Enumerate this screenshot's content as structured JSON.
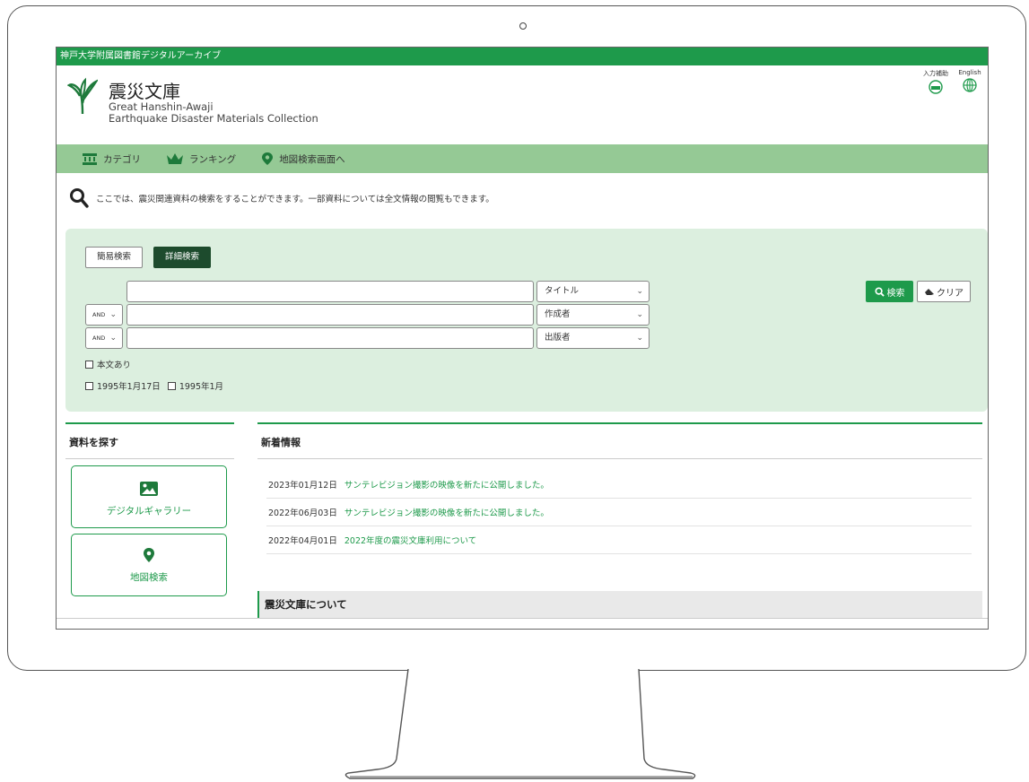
{
  "topbar": {
    "text": "神戸大学附属図書館デジタルアーカイブ"
  },
  "logo": {
    "title": "震災文庫",
    "sub1": "Great Hanshin-Awaji",
    "sub2": "Earthquake Disaster Materials Collection"
  },
  "utility": {
    "input_help": "入力補助",
    "english": "English"
  },
  "nav": {
    "category": "カテゴリ",
    "ranking": "ランキング",
    "map": "地図検索画面へ"
  },
  "intro": {
    "text": "ここでは、震災関連資料の検索をすることができます。一部資料については全文情報の閲覧もできます。"
  },
  "search": {
    "tab_simple": "簡易検索",
    "tab_advanced": "詳細検索",
    "rows": [
      {
        "value": "",
        "field": "タイトル"
      },
      {
        "op": "AND",
        "value": "",
        "field": "作成者"
      },
      {
        "op": "AND",
        "value": "",
        "field": "出版者"
      }
    ],
    "fulltext": "本文あり",
    "date1": "1995年1月17日",
    "date2": "1995年1月",
    "search_button": "検索",
    "clear_button": "クリア"
  },
  "find": {
    "heading": "資料を探す",
    "gallery": "デジタルギャラリー",
    "map": "地図検索"
  },
  "news": {
    "heading": "新着情報",
    "items": [
      {
        "date": "2023年01月12日",
        "text": "サンテレビジョン撮影の映像を新たに公開しました。"
      },
      {
        "date": "2022年06月03日",
        "text": "サンテレビジョン撮影の映像を新たに公開しました。"
      },
      {
        "date": "2022年04月01日",
        "text": "2022年度の震災文庫利用について"
      }
    ]
  },
  "about": {
    "heading": "震災文庫について"
  },
  "colors": {
    "accent": "#1e9a4b",
    "nav_bg": "#95c995",
    "panel_bg": "#dcefdf",
    "dark_tab": "#1d4b2d"
  }
}
